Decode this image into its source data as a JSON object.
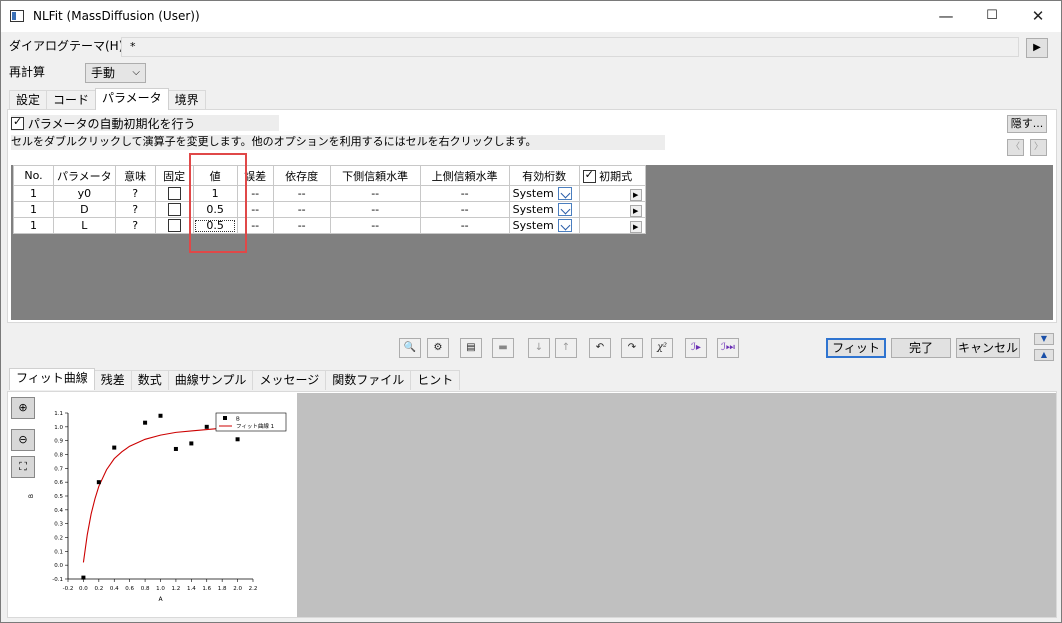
{
  "window": {
    "title": "NLFit (MassDiffusion (User))",
    "minimize": "—",
    "maximize": "☐",
    "close": "✕"
  },
  "theme": {
    "label": "ダイアログテーマ(H)",
    "value": "*",
    "arrow": "▶"
  },
  "recalc": {
    "label": "再計算",
    "value": "手動"
  },
  "top_tabs": [
    "設定",
    "コード",
    "パラメータ",
    "境界"
  ],
  "auto_init": {
    "label": "パラメータの自動初期化を行う",
    "checked": true
  },
  "info": "セルをダブルクリックして演算子を変更します。他のオプションを利用するにはセルを右クリックします。",
  "hide_button": "隠す...",
  "nav": {
    "prev": "〈",
    "next": "〉"
  },
  "table": {
    "headers": [
      "No.",
      "パラメータ",
      "意味",
      "固定",
      "値",
      "誤差",
      "依存度",
      "下側信頼水準",
      "上側信頼水準",
      "有効桁数",
      "初期式"
    ],
    "rows": [
      {
        "no": "1",
        "param": "y0",
        "meaning": "?",
        "value": "1",
        "error": "--",
        "dep": "--",
        "lower": "--",
        "upper": "--",
        "sig": "System"
      },
      {
        "no": "1",
        "param": "D",
        "meaning": "?",
        "value": "0.5",
        "error": "--",
        "dep": "--",
        "lower": "--",
        "upper": "--",
        "sig": "System"
      },
      {
        "no": "1",
        "param": "L",
        "meaning": "?",
        "value": "0.5",
        "error": "--",
        "dep": "--",
        "lower": "--",
        "upper": "--",
        "sig": "System"
      }
    ]
  },
  "actions": {
    "fit": "フィット",
    "done": "完了",
    "cancel": "キャンセル"
  },
  "bottom_tabs": [
    "フィット曲線",
    "残差",
    "数式",
    "曲線サンプル",
    "メッセージ",
    "関数ファイル",
    "ヒント"
  ],
  "chart_data": {
    "type": "scatter",
    "xlabel": "A",
    "ylabel": "B",
    "xlim": [
      -0.2,
      2.2
    ],
    "ylim": [
      -0.1,
      1.1
    ],
    "xticks": [
      "-0.2",
      "0.0",
      "0.2",
      "0.4",
      "0.6",
      "0.8",
      "1.0",
      "1.2",
      "1.4",
      "1.6",
      "1.8",
      "2.0",
      "2.2"
    ],
    "yticks": [
      "-0.1",
      "0.0",
      "0.1",
      "0.2",
      "0.3",
      "0.4",
      "0.5",
      "0.6",
      "0.7",
      "0.8",
      "0.9",
      "1.0",
      "1.1"
    ],
    "series": [
      {
        "name": "B",
        "type": "scatter",
        "color": "#000000",
        "x": [
          0.0,
          0.2,
          0.4,
          0.8,
          1.0,
          1.2,
          1.4,
          1.6,
          1.8,
          2.0
        ],
        "y": [
          -0.09,
          0.6,
          0.85,
          1.03,
          1.08,
          0.84,
          0.88,
          1.0,
          1.01,
          0.91
        ]
      },
      {
        "name": "フィット曲線 1",
        "type": "line",
        "color": "#cc0000",
        "x": [
          0.0,
          0.05,
          0.1,
          0.15,
          0.2,
          0.3,
          0.4,
          0.5,
          0.6,
          0.8,
          1.0,
          1.2,
          1.4,
          1.6,
          1.8,
          2.0
        ],
        "y": [
          0.02,
          0.22,
          0.37,
          0.48,
          0.57,
          0.69,
          0.77,
          0.82,
          0.86,
          0.91,
          0.94,
          0.96,
          0.97,
          0.98,
          0.99,
          0.99
        ]
      }
    ],
    "legend": "top-right"
  }
}
